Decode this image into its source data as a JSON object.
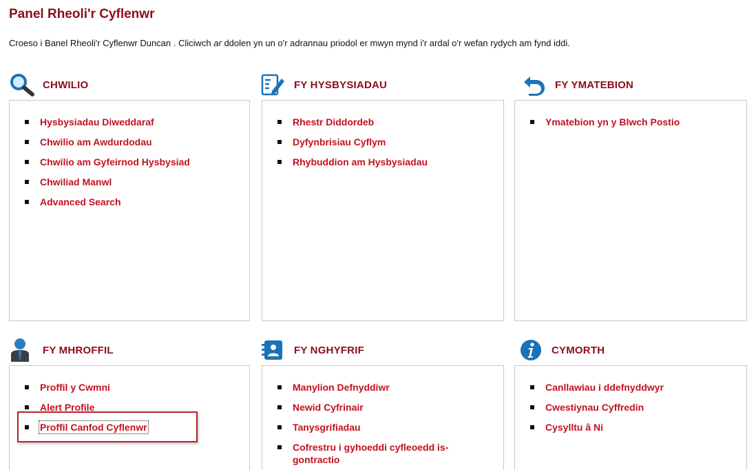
{
  "header": {
    "title": "Panel Rheoli'r Cyflenwr",
    "intro_before": "Croeso i Banel Rheoli'r Cyflenwr Duncan . Cliciwch ",
    "intro_em": "ar",
    "intro_after": " ddolen yn un o'r adrannau priodol er mwyn mynd i'r ardal o'r wefan rydych am fynd iddi."
  },
  "sections": {
    "search": {
      "title": "CHWILIO",
      "icon": "search-icon",
      "links": [
        "Hysbysiadau Diweddaraf",
        "Chwilio am Awdurdodau",
        "Chwilio am Gyfeirnod Hysbysiad",
        "Chwiliad Manwl",
        "Advanced Search"
      ]
    },
    "notices": {
      "title": "FY HYSBYSIADAU",
      "icon": "notepad-pencil-icon",
      "links": [
        "Rhestr Diddordeb",
        "Dyfynbrisiau Cyflym",
        "Rhybuddion am Hysbysiadau"
      ]
    },
    "responses": {
      "title": "FY YMATEBION",
      "icon": "reply-arrow-icon",
      "links": [
        "Ymatebion yn y Blwch Postio"
      ]
    },
    "profile": {
      "title": "FY MHROFFIL",
      "icon": "user-icon",
      "links": [
        "Proffil y Cwmni",
        "Alert Profile",
        "Proffil Canfod Cyflenwr"
      ]
    },
    "account": {
      "title": "FY NGHYFRIF",
      "icon": "contact-card-icon",
      "links": [
        "Manylion Defnyddiwr",
        "Newid Cyfrinair",
        "Tanysgrifiadau",
        "Cofrestru i gyhoeddi cyfleoedd is-gontractio"
      ]
    },
    "help": {
      "title": "CYMORTH",
      "icon": "info-icon",
      "links": [
        "Canllawiau i ddefnyddwyr",
        "Cwestiynau Cyffredin",
        "Cysylltu â Ni"
      ]
    }
  },
  "colors": {
    "title": "#8b0d1a",
    "link": "#c1121f",
    "icon_blue": "#1a73b8",
    "highlight_border": "#b8222a"
  }
}
